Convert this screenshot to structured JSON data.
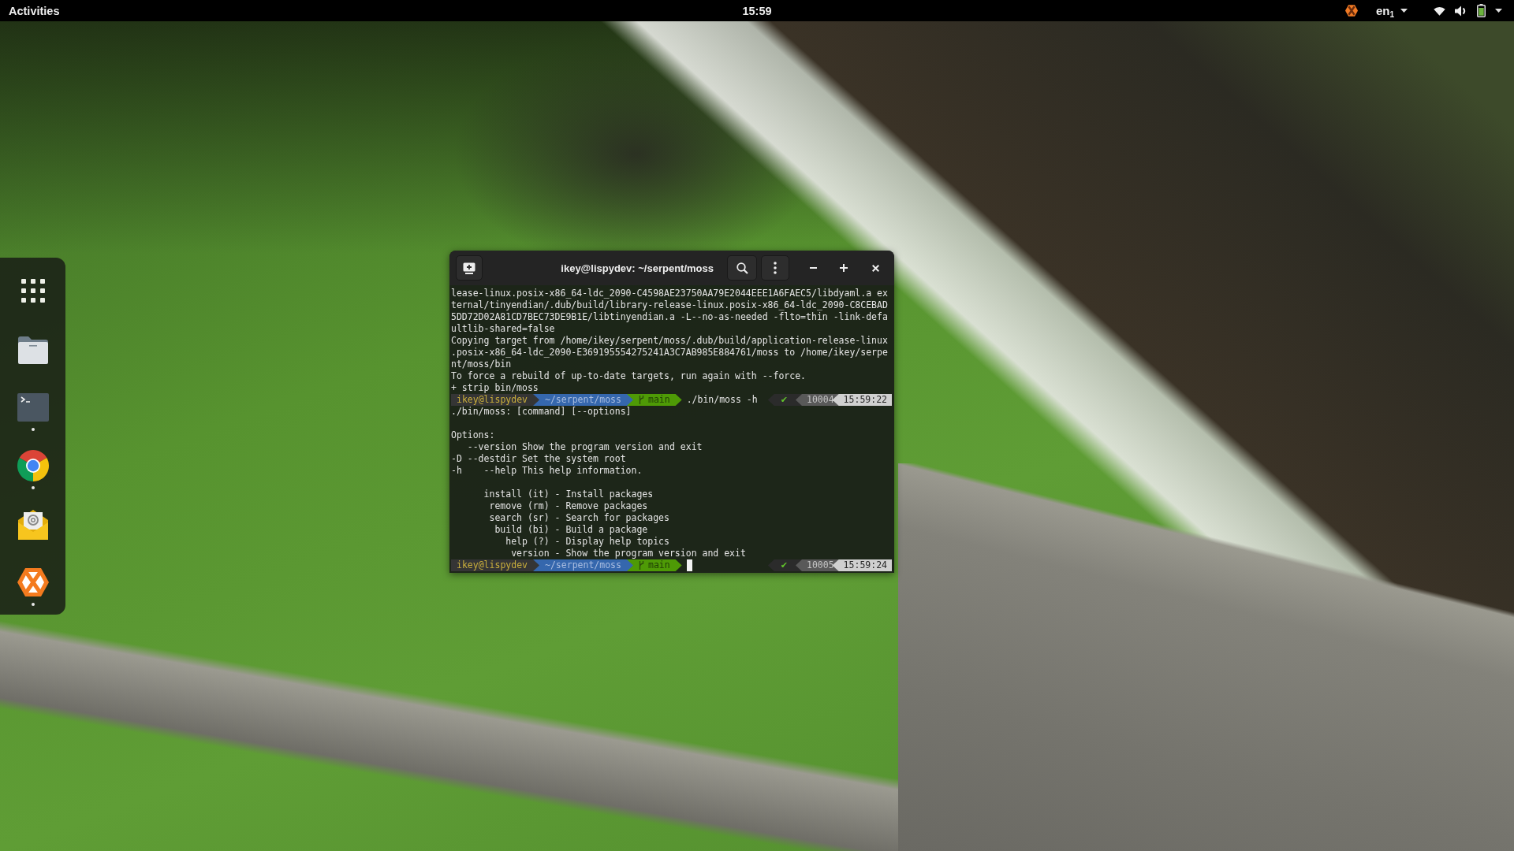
{
  "top_bar": {
    "activities": "Activities",
    "clock": "15:59",
    "keyboard_layout": "en$_{1}$"
  },
  "dock": {
    "items": [
      {
        "kind": "app-grid",
        "running": false
      },
      {
        "kind": "folder",
        "running": false
      },
      {
        "kind": "terminal",
        "running": true
      },
      {
        "kind": "browser",
        "running": true
      },
      {
        "kind": "mail",
        "running": false
      },
      {
        "kind": "hexagon",
        "running": true
      }
    ]
  },
  "terminal": {
    "title": "ikey@lispydev: ~/serpent/moss",
    "lines": [
      {
        "kind": "output",
        "text": "lease-linux.posix-x86_64-ldc_2090-C4598AE23750AA79E2044EEE1A6FAEC5/libdyaml.a ex"
      },
      {
        "kind": "output",
        "text": "ternal/tinyendian/.dub/build/library-release-linux.posix-x86_64-ldc_2090-C8CEBAD"
      },
      {
        "kind": "output",
        "text": "5DD72D02A81CD7BEC73DE9B1E/libtinyendian.a -L--no-as-needed -flto=thin -link-defa"
      },
      {
        "kind": "output",
        "text": "ultlib-shared=false"
      },
      {
        "kind": "output",
        "text": "Copying target from /home/ikey/serpent/moss/.dub/build/application-release-linux"
      },
      {
        "kind": "output",
        "text": ".posix-x86_64-ldc_2090-E369195554275241A3C7AB985E884761/moss to /home/ikey/serpe"
      },
      {
        "kind": "output",
        "text": "nt/moss/bin"
      },
      {
        "kind": "output",
        "text": "To force a rebuild of up-to-date targets, run again with --force."
      },
      {
        "kind": "output",
        "text": "+ strip bin/moss"
      },
      {
        "kind": "prompt",
        "user": "ikey@lispydev",
        "path": "~/serpent/moss",
        "branch": "main",
        "command": "./bin/moss -h",
        "cursor": false,
        "exit_status": "✔",
        "history_number": "10004",
        "time": "15:59:22"
      },
      {
        "kind": "output",
        "text": "./bin/moss: [command] [--options]"
      },
      {
        "kind": "blank"
      },
      {
        "kind": "output",
        "text": "Options:"
      },
      {
        "kind": "output",
        "text": "   --version Show the program version and exit"
      },
      {
        "kind": "output",
        "text": "-D --destdir Set the system root"
      },
      {
        "kind": "output",
        "text": "-h    --help This help information."
      },
      {
        "kind": "blank"
      },
      {
        "kind": "output",
        "text": "      install (it) - Install packages"
      },
      {
        "kind": "output",
        "text": "       remove (rm) - Remove packages"
      },
      {
        "kind": "output",
        "text": "       search (sr) - Search for packages"
      },
      {
        "kind": "output",
        "text": "        build (bi) - Build a package"
      },
      {
        "kind": "output",
        "text": "          help (?) - Display help topics"
      },
      {
        "kind": "output",
        "text": "           version - Show the program version and exit"
      },
      {
        "kind": "prompt",
        "user": "ikey@lispydev",
        "path": "~/serpent/moss",
        "branch": "main",
        "cursor": true,
        "exit_status": "✔",
        "history_number": "10005",
        "time": "15:59:24"
      }
    ]
  }
}
